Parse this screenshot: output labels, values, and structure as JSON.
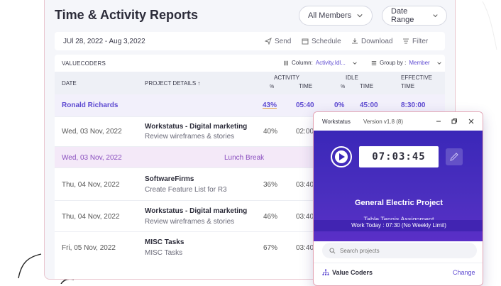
{
  "report": {
    "title": "Time & Activity Reports",
    "members_dropdown": "All Members",
    "date_range_dropdown": "Date Range",
    "date_range_text": "JUl 28, 2022 - Aug 3,2022",
    "actions": [
      "Send",
      "Schedule",
      "Download",
      "Filter"
    ],
    "company": "VALUECODERS",
    "column_label": "Column:",
    "column_value": "Activity,Idl...",
    "group_label": "Group by :",
    "group_value": "Member",
    "headers": {
      "date": "DATE",
      "project_details": "PROJECT DETAILS",
      "activity": "ACTIVITY",
      "activity_pct": "%",
      "activity_time": "TIME",
      "idle": "IDLE",
      "idle_pct": "%",
      "idle_time": "TIME",
      "effective": "EFFECTIVE",
      "effective_time": "TIME"
    },
    "summary": {
      "name": "Ronald Richards",
      "activity_pct": "43%",
      "activity_time": "05:40",
      "idle_pct": "0%",
      "idle_time": "45:00",
      "effective_time": "8:30:00"
    },
    "rows": [
      {
        "date": "Wed, 03 Nov, 2022",
        "project": "Workstatus - Digital marketing",
        "task": "Review wireframes & stories",
        "pct": "40%",
        "time": "02:00"
      },
      {
        "date": "Wed, 03 Nov, 2022",
        "break_label": "Lunch Break"
      },
      {
        "date": "Thu, 04 Nov, 2022",
        "project": "SoftwareFirms",
        "task": "Create Feature List for R3",
        "pct": "36%",
        "time": "03:40"
      },
      {
        "date": "Thu, 04 Nov, 2022",
        "project": "Workstatus - Digital marketing",
        "task": "Review wireframes & stories",
        "pct": "46%",
        "time": "03:40"
      },
      {
        "date": "Fri, 05 Nov, 2022",
        "project": "MISC Tasks",
        "task": "MISC Tasks",
        "pct": "67%",
        "time": "03:40"
      }
    ]
  },
  "widget": {
    "app_name": "Workstatus",
    "version": "Version v1.8 (8)",
    "timer": "07:03:45",
    "project": "General Electric Project",
    "task": "Table Tennis Assignment",
    "work_today": "Work Today : 07:30 (No Weekly Limit)",
    "search_placeholder": "Search projects",
    "organization": "Value Coders",
    "change_label": "Change"
  },
  "colors": {
    "accent": "#5e4ad1",
    "widget_bg": "#3a27b8",
    "break_text": "#8a4fbf"
  }
}
